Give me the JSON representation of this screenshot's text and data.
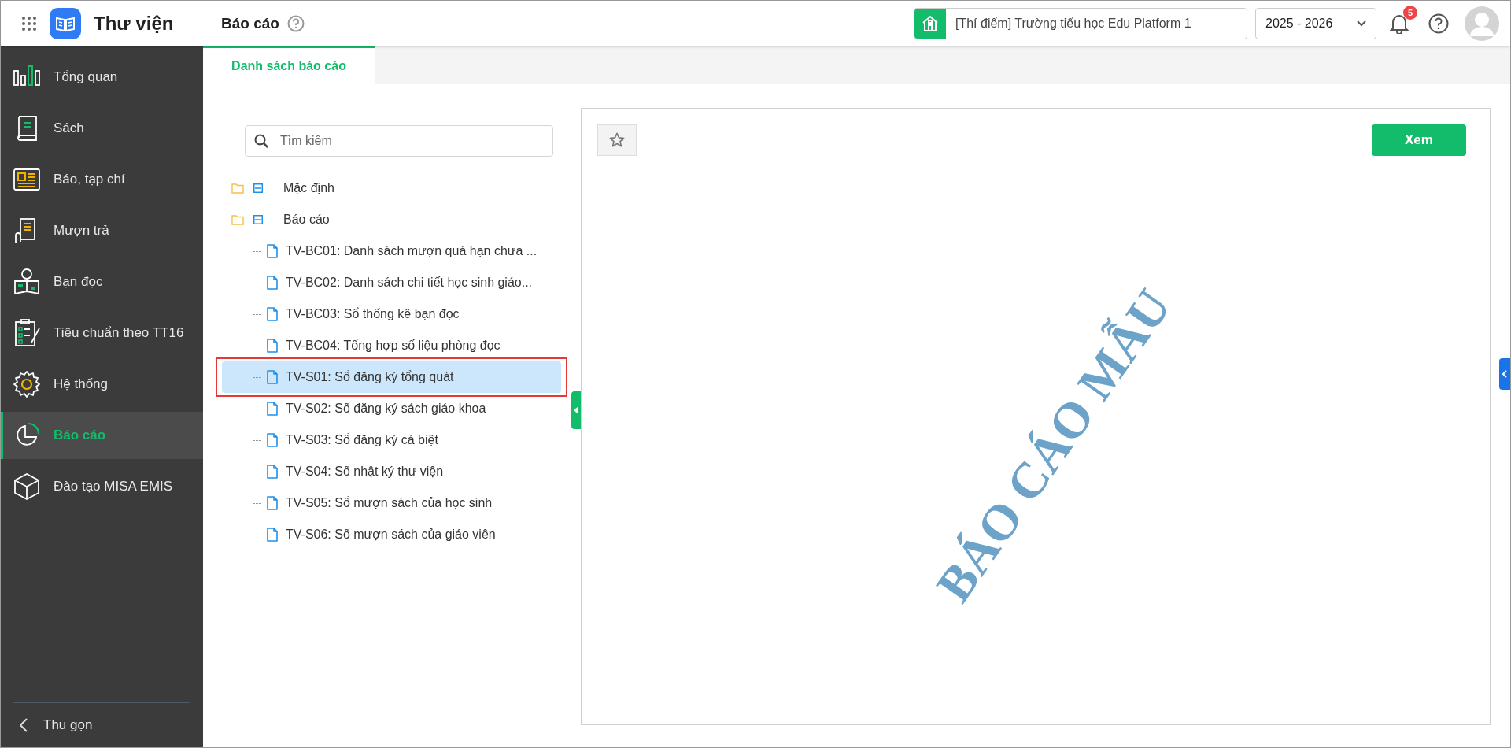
{
  "app": {
    "title": "Thư viện"
  },
  "header": {
    "page_title": "Báo cáo",
    "school": "[Thí điểm] Trường tiểu học Edu Platform 1",
    "school_year": "2025 - 2026",
    "notification_count": "5"
  },
  "sidebar": {
    "items": [
      {
        "label": "Tổng quan",
        "selected": false
      },
      {
        "label": "Sách",
        "selected": false
      },
      {
        "label": "Báo, tạp chí",
        "selected": false
      },
      {
        "label": "Mượn trả",
        "selected": false
      },
      {
        "label": "Bạn đọc",
        "selected": false
      },
      {
        "label": "Tiêu chuẩn theo TT16",
        "selected": false
      },
      {
        "label": "Hệ thống",
        "selected": false
      },
      {
        "label": "Báo cáo",
        "selected": true
      },
      {
        "label": "Đào tạo MISA EMIS",
        "selected": false
      }
    ],
    "collapse": "Thu gọn"
  },
  "tabs": [
    {
      "label": "Danh sách báo cáo",
      "selected": true
    }
  ],
  "search": {
    "placeholder": "Tìm kiếm"
  },
  "tree": [
    {
      "label": "Mặc định",
      "expanded": true
    },
    {
      "label": "Báo cáo",
      "expanded": true,
      "children": [
        {
          "label": "TV-BC01: Danh sách mượn quá hạn chưa ...",
          "selected": false
        },
        {
          "label": "TV-BC02: Danh sách chi tiết học sinh giáo...",
          "selected": false
        },
        {
          "label": "TV-BC03: Sổ thống kê bạn đọc",
          "selected": false
        },
        {
          "label": "TV-BC04: Tổng hợp số liệu phòng đọc",
          "selected": false
        },
        {
          "label": "TV-S01: Sổ đăng ký tổng quát",
          "selected": true
        },
        {
          "label": "TV-S02: Sổ đăng ký sách giáo khoa",
          "selected": false
        },
        {
          "label": "TV-S03: Sổ đăng ký cá biệt",
          "selected": false
        },
        {
          "label": "TV-S04: Sổ nhật ký thư viện",
          "selected": false
        },
        {
          "label": "TV-S05: Sổ mượn sách của học sinh",
          "selected": false
        },
        {
          "label": "TV-S06: Sổ mượn sách của giáo viên",
          "selected": false
        }
      ]
    }
  ],
  "preview": {
    "view_button": "Xem",
    "sample_stamp": "BÁO CÁO MẪU"
  }
}
